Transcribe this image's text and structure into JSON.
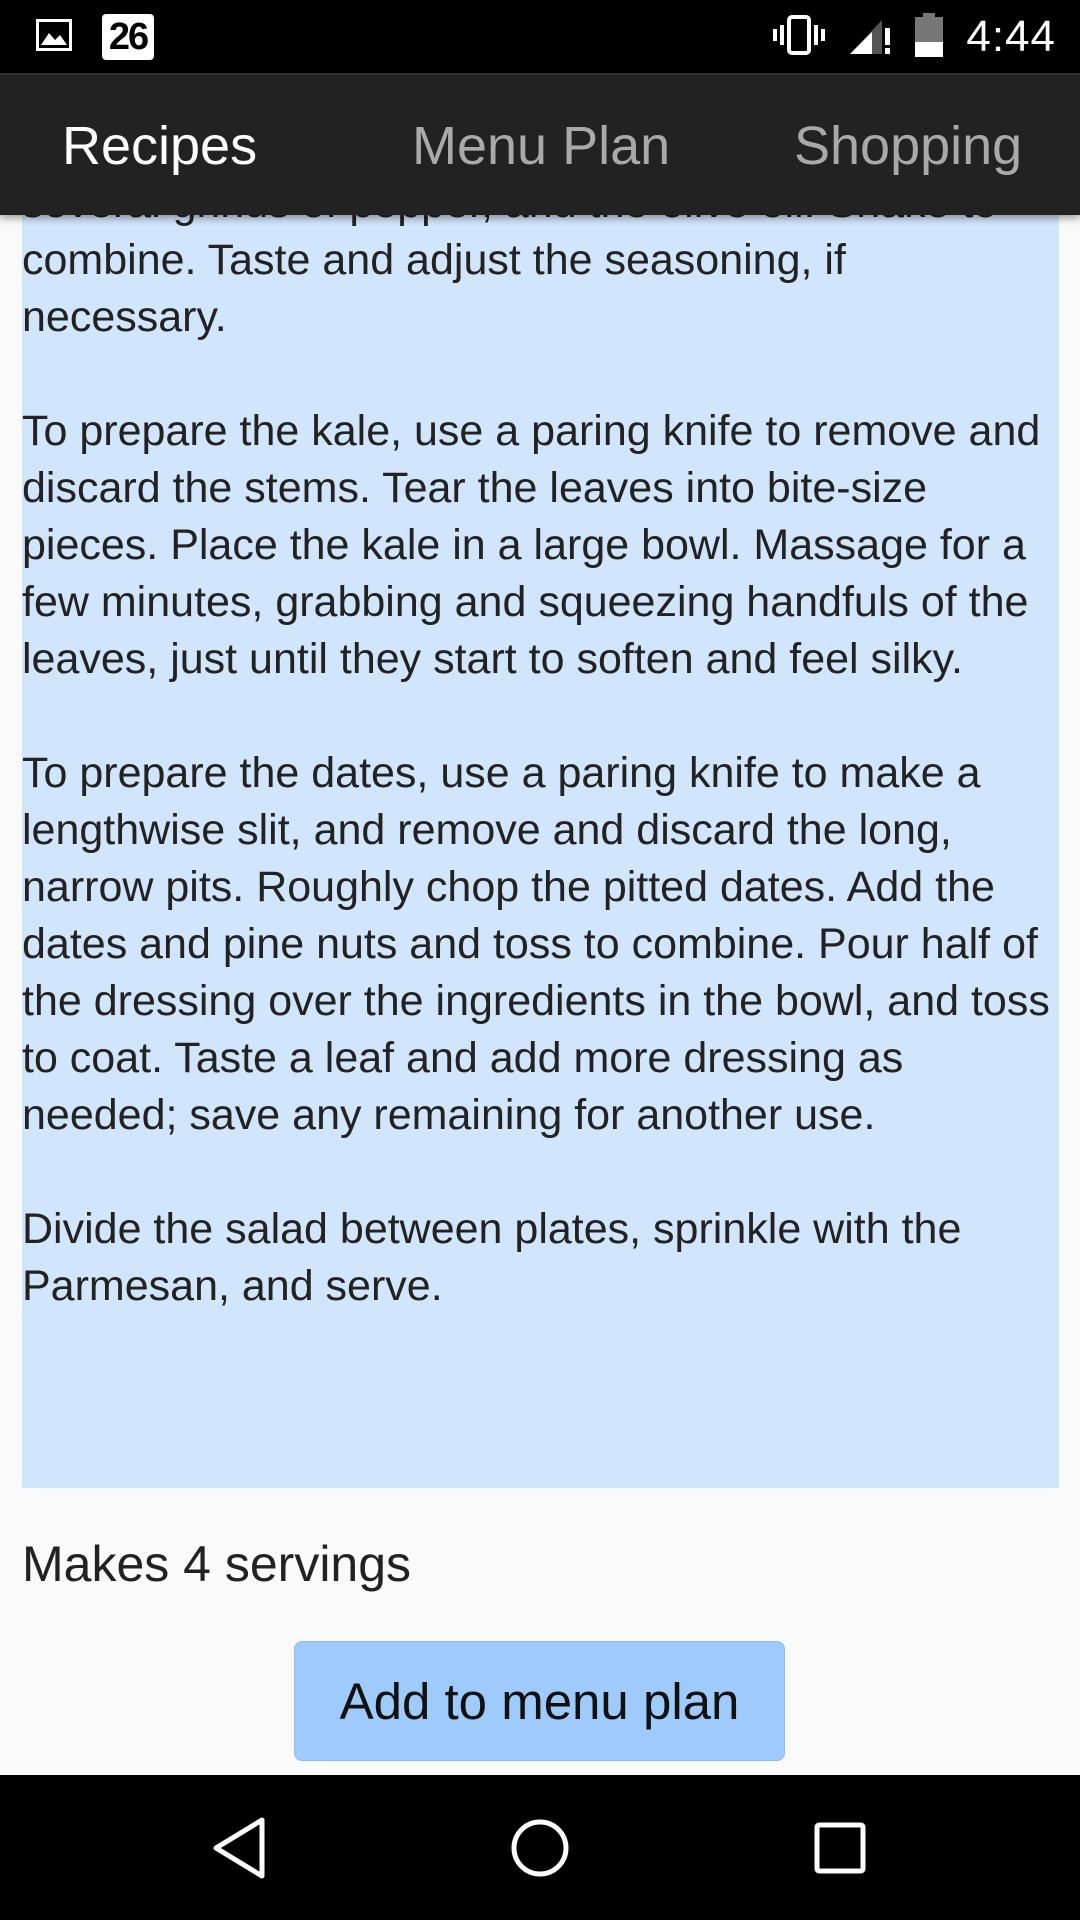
{
  "status_bar": {
    "time": "4:44",
    "notification_date": "26",
    "icons": [
      "image-icon",
      "calendar-icon",
      "vibrate-icon",
      "signal-icon",
      "battery-icon"
    ]
  },
  "tabs": [
    {
      "label": "Recipes",
      "active": true
    },
    {
      "label": "Menu Plan",
      "active": false
    },
    {
      "label": "Shopping",
      "active": false
    }
  ],
  "recipe": {
    "instructions": [
      "several grinds of pepper, and the olive oil. Shake to combine. Taste and adjust the seasoning, if necessary.",
      "To prepare the kale, use a paring knife to remove and discard the stems. Tear the leaves into bite-size pieces. Place the kale in a large bowl. Massage for a few minutes, grabbing and squeezing handfuls of the leaves, just until they start to soften and feel silky.",
      "To prepare the dates, use a paring knife to make a lengthwise slit, and remove and discard the long, narrow pits. Roughly chop the pitted dates. Add the dates and pine nuts and toss to combine. Pour half of the dressing over the ingredients in the bowl, and toss to coat. Taste a leaf and add more dressing as needed; save any remaining for another use.",
      "Divide the salad between plates, sprinkle with the Parmesan, and serve."
    ],
    "servings": "Makes 4 servings",
    "add_button_label": "Add to menu plan"
  },
  "colors": {
    "tab_bar": "#222222",
    "instructions_bg": "#d1e5fc",
    "button_bg": "#9ecbfc"
  }
}
